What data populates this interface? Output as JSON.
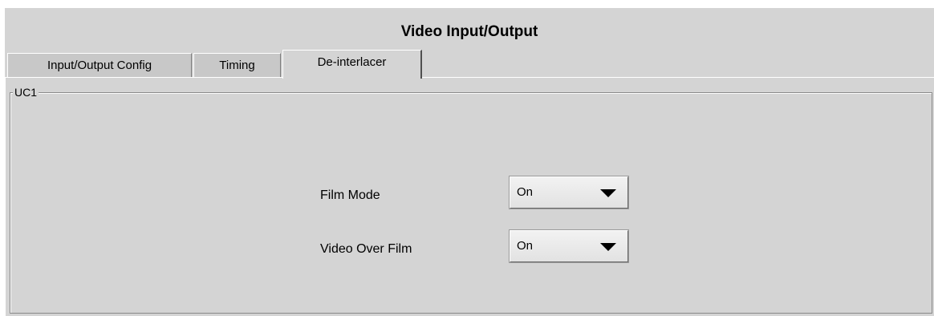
{
  "window": {
    "title": "Video Input/Output"
  },
  "tabs": [
    {
      "label": "Input/Output Config"
    },
    {
      "label": "Timing"
    },
    {
      "label": "De-interlacer"
    }
  ],
  "group": {
    "label": "UC1"
  },
  "fields": {
    "film_mode": {
      "label": "Film Mode",
      "value": "On"
    },
    "video_over_film": {
      "label": "Video Over Film",
      "value": "On"
    }
  }
}
